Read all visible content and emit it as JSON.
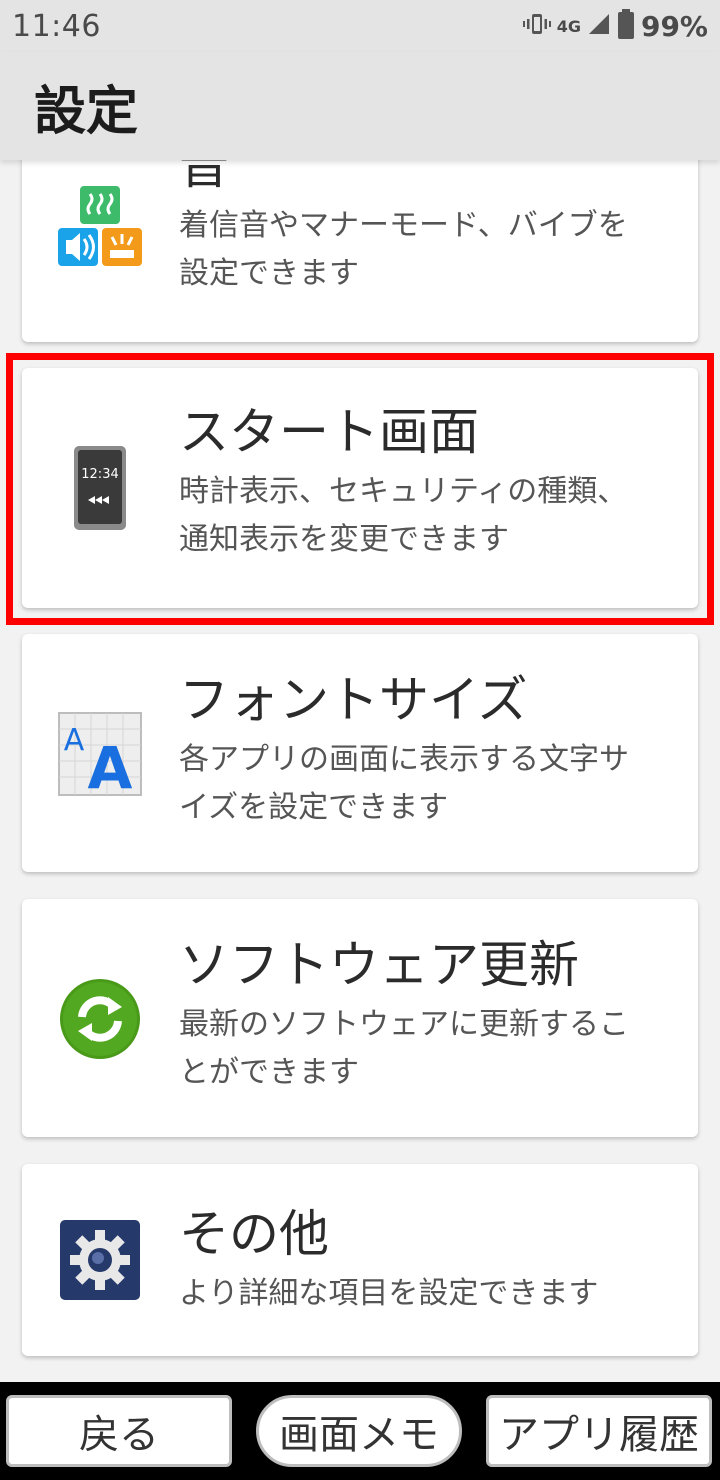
{
  "status": {
    "time": "11:46",
    "network": "4G",
    "battery": "99%",
    "icons": [
      "vibrate-icon",
      "signal-icon",
      "battery-icon"
    ]
  },
  "header": {
    "title": "設定"
  },
  "cards": [
    {
      "title": "音",
      "desc_line1": "着信音やマナーモード、バイブを",
      "desc_line2": "設定できます",
      "icon": "sound-icon"
    },
    {
      "title": "スタート画面",
      "desc_line1": "時計表示、セキュリティの種類、",
      "desc_line2": "通知表示を変更できます",
      "icon": "start-screen-icon",
      "icon_time": "12:34"
    },
    {
      "title": "フォントサイズ",
      "desc_line1": "各アプリの画面に表示する文字サ",
      "desc_line2": "イズを設定できます",
      "icon": "font-size-icon"
    },
    {
      "title": "ソフトウェア更新",
      "desc_line1": "最新のソフトウェアに更新するこ",
      "desc_line2": "とができます",
      "icon": "software-update-icon"
    },
    {
      "title": "その他",
      "desc_line1": "より詳細な項目を設定できます",
      "desc_line2": "",
      "icon": "gear-icon"
    }
  ],
  "nav": {
    "back": "戻る",
    "memo": "画面メモ",
    "history": "アプリ履歴"
  },
  "colors": {
    "highlight": "#ff0000",
    "update_green": "#4a9a1a",
    "font_blue": "#1a6fe0",
    "gear_navy": "#26396b"
  }
}
